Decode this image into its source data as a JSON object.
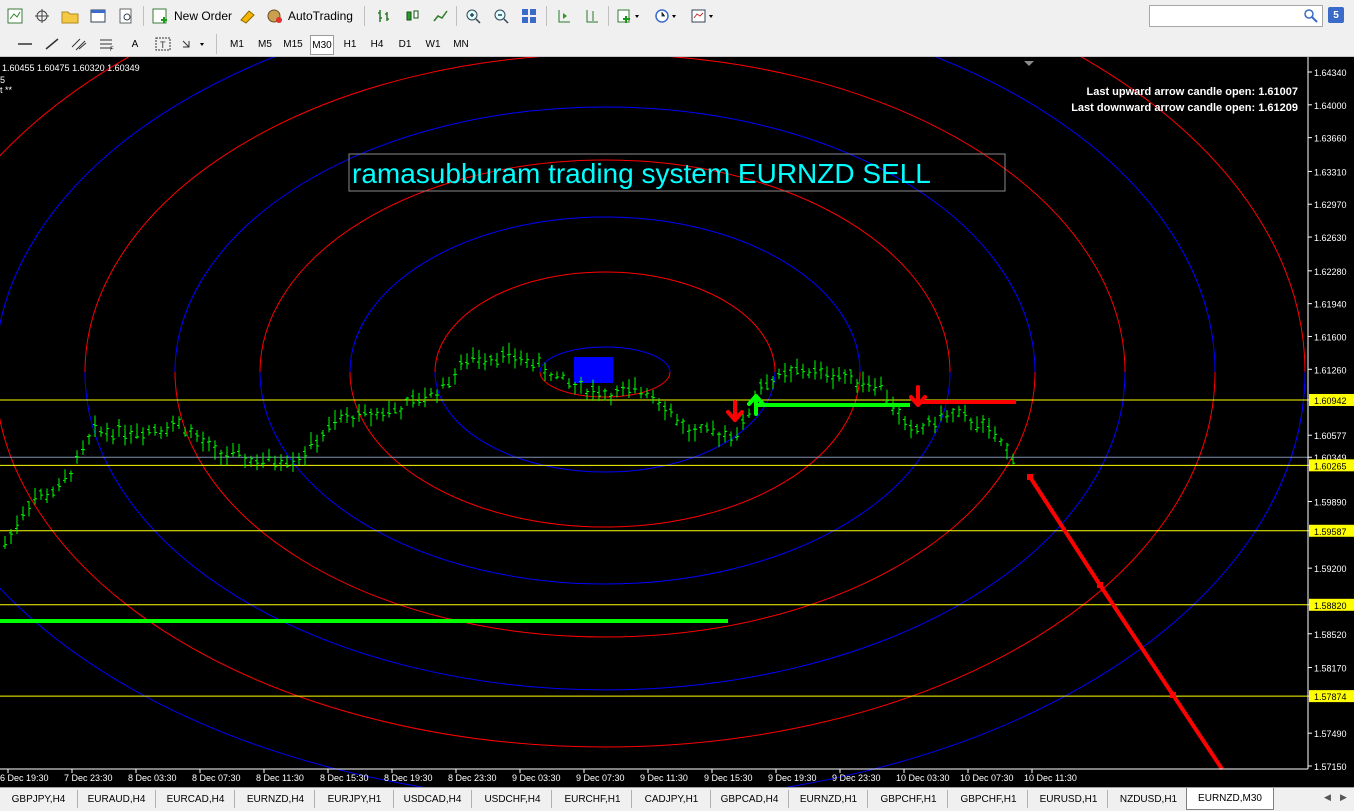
{
  "toolbar": {
    "new_order_label": "New Order",
    "autotrading_label": "AutoTrading",
    "timeframes": [
      "M1",
      "M5",
      "M15",
      "M30",
      "H1",
      "H4",
      "D1",
      "W1",
      "MN"
    ],
    "active_timeframe": "M30",
    "draw_tools": [
      "A"
    ]
  },
  "search": {
    "placeholder": ""
  },
  "help_label": "5",
  "chart": {
    "ohlc_text": "1.60455 1.60475 1.60320 1.60349",
    "indicator_line1": "5",
    "indicator_line2": "t **",
    "title_text": "ramasubburam trading system EURNZD SELL",
    "info_up": "Last upward arrow candle open: 1.61007",
    "info_down": "Last downward arrow candle open: 1.61209",
    "price_labels": [
      "1.64340",
      "1.64000",
      "1.63660",
      "1.63310",
      "1.62970",
      "1.62630",
      "1.62280",
      "1.61940",
      "1.61600",
      "1.61260",
      "1.60942",
      "1.60577",
      "1.60349",
      "1.60265",
      "1.59890",
      "1.59587",
      "1.59200",
      "1.58820",
      "1.58520",
      "1.58170",
      "1.57874",
      "1.57490",
      "1.57150"
    ],
    "time_labels": [
      "6 Dec 19:30",
      "7 Dec 23:30",
      "8 Dec 03:30",
      "8 Dec 07:30",
      "8 Dec 11:30",
      "8 Dec 15:30",
      "8 Dec 19:30",
      "8 Dec 23:30",
      "9 Dec 03:30",
      "9 Dec 07:30",
      "9 Dec 11:30",
      "9 Dec 15:30",
      "9 Dec 19:30",
      "9 Dec 23:30",
      "10 Dec 03:30",
      "10 Dec 07:30",
      "10 Dec 11:30"
    ],
    "colors": {
      "bullish": "#00ff00",
      "level_line": "#ffff00",
      "spiral_blue": "#0000ff",
      "spiral_red": "#ff0000",
      "title": "#00ffff"
    }
  },
  "tabs": [
    "GBPJPY,H4",
    "EURAUD,H4",
    "EURCAD,H4",
    "EURNZD,H4",
    "EURJPY,H1",
    "USDCAD,H4",
    "USDCHF,H4",
    "EURCHF,H1",
    "CADJPY,H1",
    "GBPCAD,H4",
    "EURNZD,H1",
    "GBPCHF,H1",
    "GBPCHF,H1",
    "EURUSD,H1",
    "NZDUSD,H1",
    "EURNZD,M30"
  ],
  "active_tab": "EURNZD,M30"
}
